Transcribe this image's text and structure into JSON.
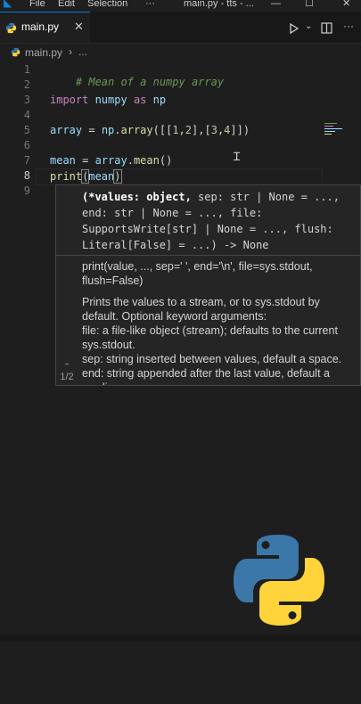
{
  "titlebar": {
    "menu": [
      "File",
      "Edit",
      "Selection",
      "···"
    ],
    "title": "main.py - tts - ..."
  },
  "tab": {
    "label": "main.py",
    "close": "✕"
  },
  "breadcrumb": {
    "file": "main.py",
    "more": "..."
  },
  "editor": {
    "line_numbers": [
      "1",
      "2",
      "3",
      "4",
      "5",
      "6",
      "7",
      "8",
      "9"
    ],
    "lines": {
      "l1": "# Mean of a numpy array",
      "l3_kw": "import",
      "l3_mod": " numpy ",
      "l3_as": "as",
      "l3_alias": " np",
      "l5_var": "array",
      "l5_eq": " = ",
      "l5_mod": "np",
      "l5_dot": ".",
      "l5_fn": "array",
      "l5_args_a": "([[",
      "l5_n1": "1",
      "l5_c1": ",",
      "l5_n2": "2",
      "l5_mid": "],[",
      "l5_n3": "3",
      "l5_c2": ",",
      "l5_n4": "4",
      "l5_end": "]])",
      "l7_var": "mean",
      "l7_eq": " = ",
      "l7_obj": "array",
      "l7_dot": ".",
      "l7_fn": "mean",
      "l7_paren": "()",
      "l8_fn": "print",
      "l8_open": "(",
      "l8_arg": "mean",
      "l8_close": ")"
    }
  },
  "hover": {
    "signature_bold": "(*values: object,",
    "signature_rest": " sep: str | None = ..., end: str | None = ..., file: SupportsWrite[str] | None = ..., flush: Literal[False] = ...) -> None",
    "doc_sig": "print(value, ..., sep=' ', end='\\n', file=sys.stdout, flush=False)",
    "doc_body_1": "Prints the values to a stream, or to sys.stdout by default. Optional keyword arguments:",
    "doc_body_2": "file: a file-like object (stream); defaults to the current sys.stdout.",
    "doc_body_3": "sep: string inserted between values, default a space.",
    "doc_body_4": "end: string appended after the last value, default a newline.",
    "pager": "1/2"
  },
  "colors": {
    "accent": "#0078d4",
    "background": "#1e1e1e"
  }
}
